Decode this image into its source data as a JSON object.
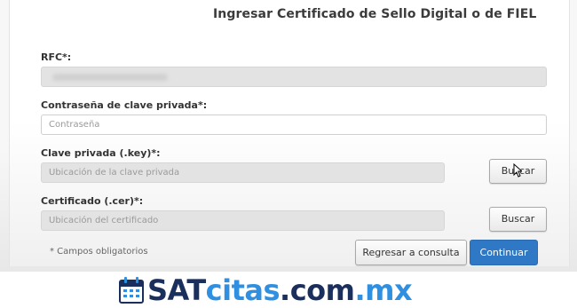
{
  "form": {
    "title": "Ingresar Certificado de Sello Digital o de FIEL",
    "rfc": {
      "label": "RFC*:",
      "value": ""
    },
    "password": {
      "label": "Contraseña de clave privada*:",
      "placeholder": "Contraseña"
    },
    "private_key": {
      "label": "Clave privada (.key)*:",
      "placeholder": "Ubicación de la clave privada",
      "button": "Buscar"
    },
    "certificate": {
      "label": "Certificado (.cer)*:",
      "placeholder": "Ubicación del certificado",
      "button": "Buscar"
    },
    "required_note": "* Campos obligatorios",
    "back_button": "Regresar a consulta",
    "continue_button": "Continuar"
  },
  "colors": {
    "primary": "#2f78c6",
    "brand_dark": "#1b2f5c",
    "brand_light": "#2f8fe0"
  },
  "icons": {
    "cursor": "mouse-pointer-icon",
    "calendar": "calendar-icon"
  },
  "watermark": {
    "part1": "SAT",
    "part2": "citas",
    "part3": ".com",
    "part4": ".mx"
  }
}
